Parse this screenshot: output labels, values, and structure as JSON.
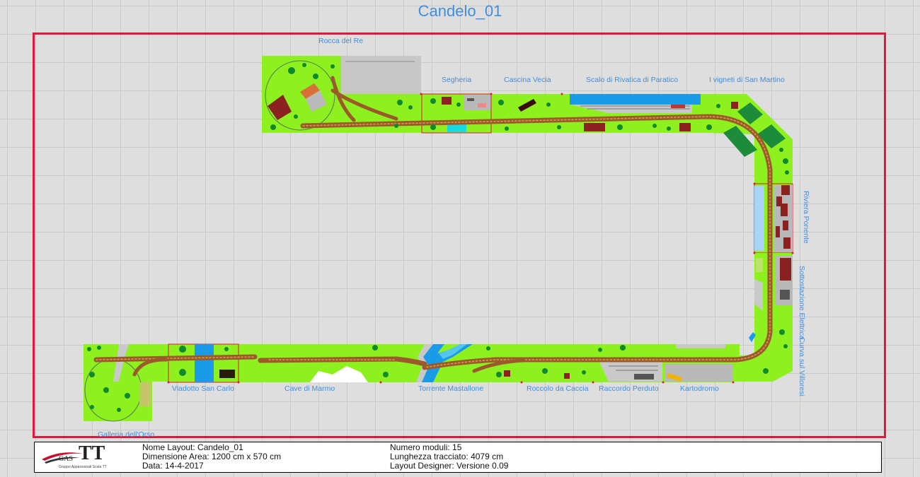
{
  "title": "Candelo_01",
  "labels": {
    "rocca": "Rocca del Re",
    "segheria": "Segheria",
    "cascina": "Cascina Vecia",
    "scalo": "Scalo di Rivatica di Paratico",
    "vigneti": "I vigneti di San Martino",
    "riviera": "Riviera Ponente",
    "sotto": "Sottostazione Elettrica",
    "curva": "Curva sul Villoresi",
    "viadotto": "Viadotto San Carlo",
    "cave": "Cave di Marmo",
    "torrente": "Torrente Mastallone",
    "roccolo": "Roccolo da Caccia",
    "raccordo": "Raccordo Perduto",
    "kartodromo": "Kartodromo",
    "galleria": "Galleria dell'Orso"
  },
  "info": {
    "logo_main": "TT",
    "logo_gas": "GAS",
    "logo_sub": "Gruppo Appassionati Scala TT",
    "nome": "Nome Layout: Candelo_01",
    "dimensione": "Dimensione Area: 1200 cm x 570 cm",
    "data": "Data: 14-4-2017",
    "moduli": "Numero moduli: 15",
    "lunghezza": "Lunghezza tracciato: 4079 cm",
    "designer": "Layout Designer: Versione 0.09"
  },
  "colors": {
    "grass": "#8ef01f",
    "track": "#9b5a2a",
    "border": "#dc1a3c",
    "label": "#3f8ee0",
    "water": "#1a9be8"
  }
}
